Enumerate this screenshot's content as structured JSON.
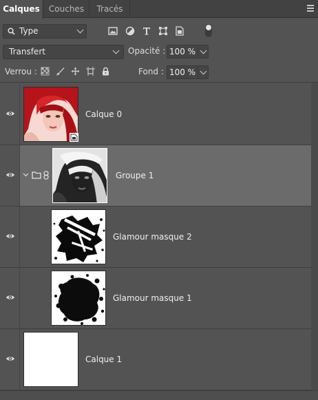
{
  "tabs": [
    {
      "label": "Calques",
      "active": true
    },
    {
      "label": "Couches",
      "active": false
    },
    {
      "label": "Tracés",
      "active": false
    }
  ],
  "filter": {
    "kind_label": "Type",
    "icons": [
      "image-filter-icon",
      "adjustment-filter-icon",
      "type-filter-icon",
      "shape-filter-icon",
      "smart-object-filter-icon"
    ]
  },
  "blend": {
    "mode": "Transfert",
    "opacity_label": "Opacité :",
    "opacity_value": "100 %"
  },
  "lock": {
    "label": "Verrou :",
    "fill_label": "Fond :",
    "fill_value": "100 %",
    "icons": [
      "lock-transparent-icon",
      "lock-image-icon",
      "lock-position-icon",
      "lock-artboard-icon",
      "lock-all-icon"
    ]
  },
  "layers": [
    {
      "name": "Calque 0",
      "type": "smart-object",
      "visible": true,
      "selected": false
    },
    {
      "name": "Groupe 1",
      "type": "group",
      "visible": true,
      "selected": true,
      "expanded": true
    },
    {
      "name": "Glamour masque 2",
      "type": "layer",
      "visible": true,
      "selected": false
    },
    {
      "name": "Glamour masque 1",
      "type": "layer",
      "visible": true,
      "selected": false
    },
    {
      "name": "Calque 1",
      "type": "layer",
      "visible": true,
      "selected": false
    }
  ],
  "colors": {
    "panel_bg": "#535353",
    "selected_row": "#6b6b6b",
    "tabbar_bg": "#424242"
  }
}
